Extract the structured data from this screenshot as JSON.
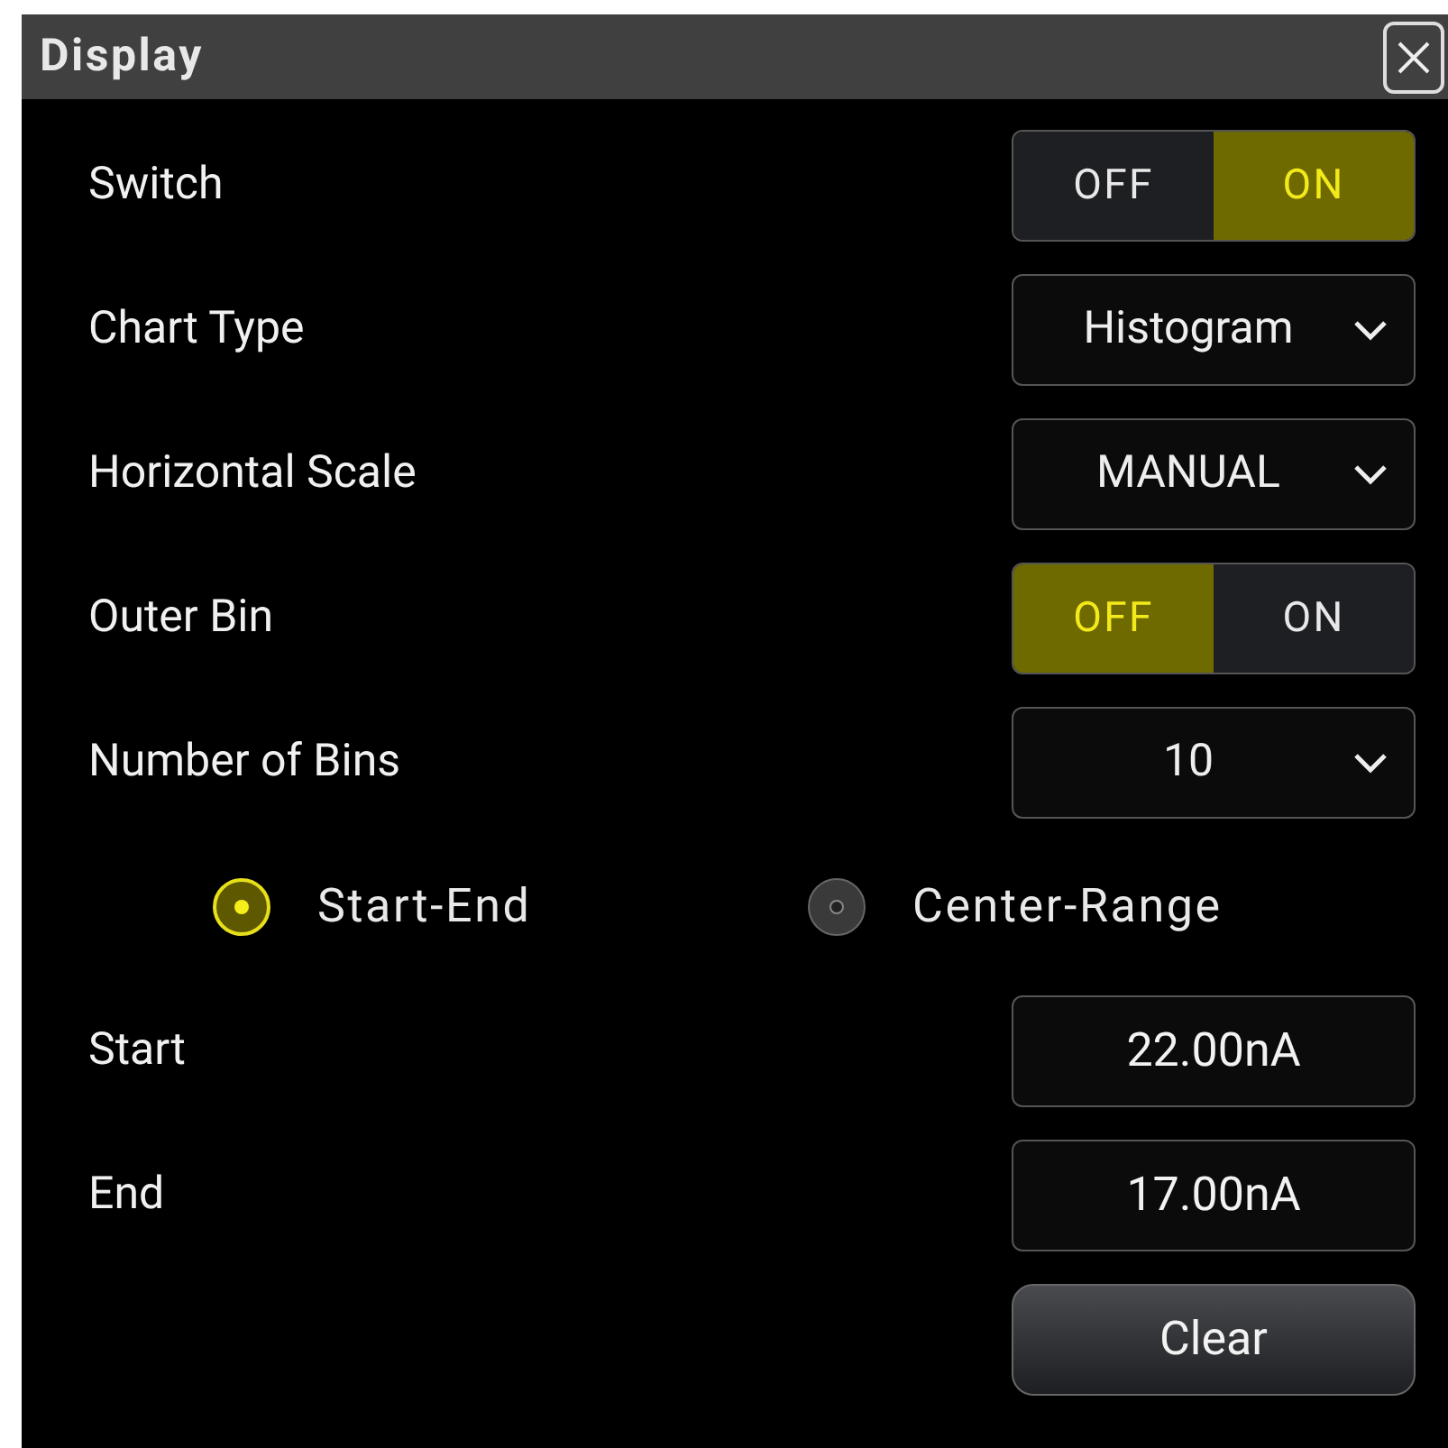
{
  "dialog": {
    "title": "Display"
  },
  "rows": [
    {
      "kind": "toggle",
      "label": "Switch",
      "options": [
        {
          "label": "OFF",
          "selected": false
        },
        {
          "label": "ON",
          "selected": true
        }
      ]
    },
    {
      "kind": "dropdown",
      "label": "Chart Type",
      "value": "Histogram"
    },
    {
      "kind": "dropdown",
      "label": "Horizontal Scale",
      "value": "MANUAL"
    },
    {
      "kind": "toggle",
      "label": "Outer Bin",
      "options": [
        {
          "label": "OFF",
          "selected": true
        },
        {
          "label": "ON",
          "selected": false
        }
      ]
    },
    {
      "kind": "dropdown",
      "label": "Number of Bins",
      "value": "10"
    },
    {
      "kind": "radio",
      "options": [
        {
          "label": "Start-End",
          "selected": true
        },
        {
          "label": "Center-Range",
          "selected": false
        }
      ]
    },
    {
      "kind": "field",
      "label": "Start",
      "value": "22.00nA"
    },
    {
      "kind": "field",
      "label": "End",
      "value": "17.00nA"
    },
    {
      "kind": "button",
      "label": "Clear"
    }
  ]
}
